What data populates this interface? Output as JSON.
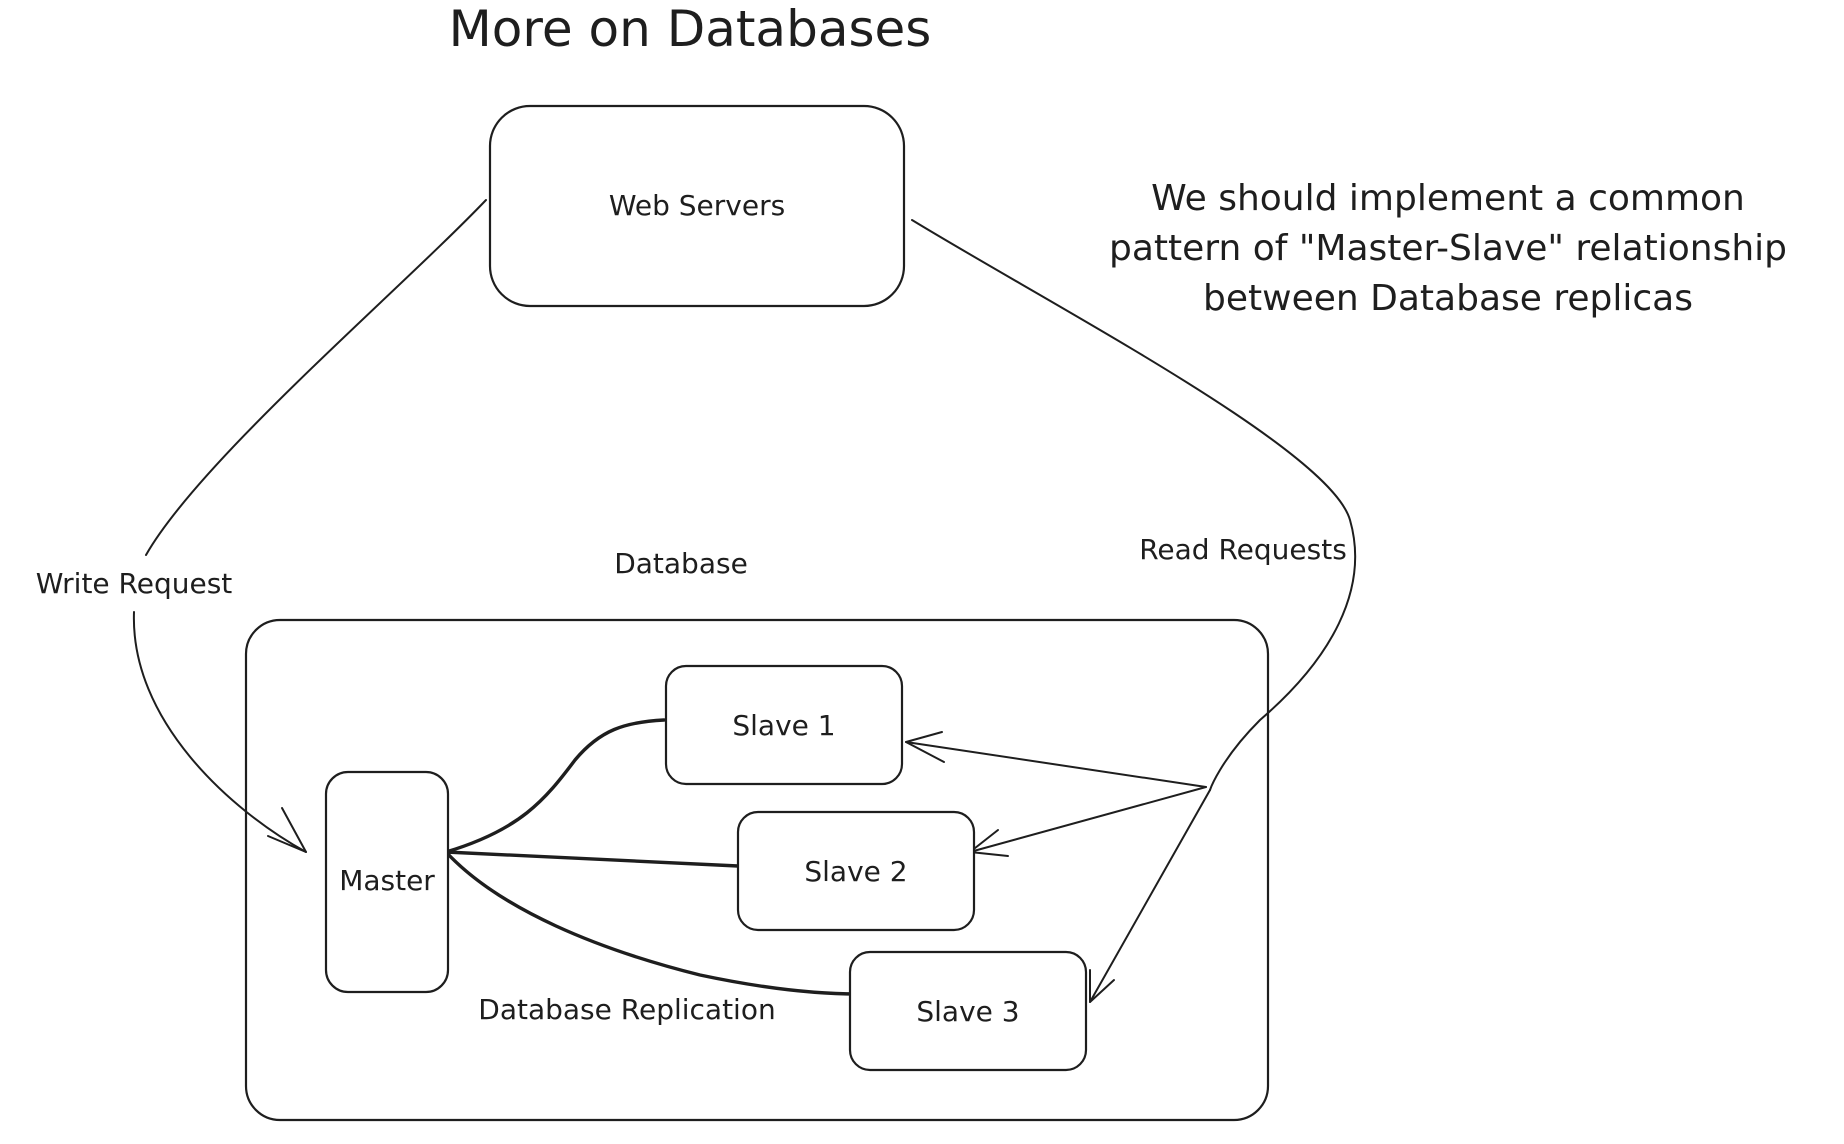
{
  "title": "More on Databases",
  "note": {
    "lines": [
      "We should implement a common",
      "pattern of \"Master-Slave\" relationship",
      "between Database replicas"
    ]
  },
  "nodes": {
    "web_servers": "Web Servers",
    "database_group": "Database",
    "master": "Master",
    "slave_1": "Slave 1",
    "slave_2": "Slave 2",
    "slave_3": "Slave 3"
  },
  "edge_labels": {
    "write_request": "Write Request",
    "read_requests": "Read Requests",
    "replication": "Database Replication"
  }
}
